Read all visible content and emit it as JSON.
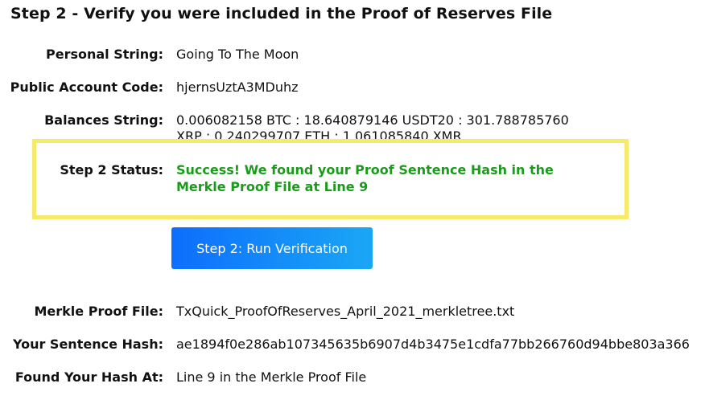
{
  "title": "Step 2 - Verify you were included in the Proof of Reserves File",
  "fields": {
    "personal_string": {
      "label": "Personal String:",
      "value": "Going To The Moon"
    },
    "public_account_code": {
      "label": "Public Account Code:",
      "value": "hjernsUztA3MDuhz"
    },
    "balances_string": {
      "label": "Balances String:",
      "value": "0.006082158 BTC : 18.640879146 USDT20 : 301.788785760 XRP : 0.240299707 ETH : 1.061085840 XMR"
    },
    "step2_status": {
      "label": "Step 2 Status:",
      "value": "Success! We found your Proof Sentence Hash in the Merkle Proof File at Line 9"
    }
  },
  "button": {
    "label": "Step 2: Run Verification"
  },
  "results": {
    "merkle_proof_file": {
      "label": "Merkle Proof File:",
      "value": "TxQuick_ProofOfReserves_April_2021_merkletree.txt"
    },
    "sentence_hash": {
      "label": "Your Sentence Hash:",
      "value": "ae1894f0e286ab107345635b6907d4b3475e1cdfa77bb266760d94bbe803a366"
    },
    "found_at": {
      "label": "Found Your Hash At:",
      "value": "Line 9 in the Merkle Proof File"
    }
  },
  "colors": {
    "success": "#1b9b1b",
    "highlight_border": "#f7e96a",
    "button_start": "#0d6efd",
    "button_end": "#1aa7f5"
  }
}
